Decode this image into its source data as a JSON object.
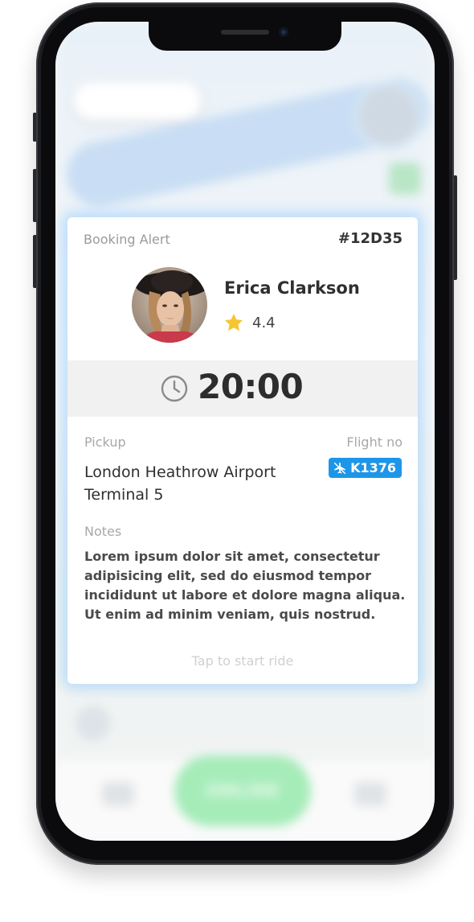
{
  "booking_card": {
    "title": "Booking Alert",
    "booking_id": "#12D35",
    "driver": {
      "name": "Erica Clarkson",
      "rating": "4.4",
      "rating_icon": "star-icon",
      "avatar_icon": "driver-photo"
    },
    "pickup_time": "20:00",
    "time_icon": "clock-icon",
    "pickup": {
      "label": "Pickup",
      "value": "London Heathrow Airport Terminal 5"
    },
    "flight": {
      "label": "Flight no",
      "value": "K1376",
      "icon": "airplane-icon"
    },
    "notes": {
      "label": "Notes",
      "value": "Lorem ipsum dolor sit amet, consectetur adipisicing elit, sed do eiusmod tempor incididunt ut labore et dolore magna aliqua. Ut enim ad minim veniam, quis nostrud."
    },
    "action_label": "Tap to start ride"
  },
  "background": {
    "status_button_label": "ONLINE"
  },
  "colors": {
    "accent_blue": "#1e96e8",
    "star_yellow": "#f7c531",
    "online_green": "#a6ecb9",
    "card_glow": "#78beff"
  }
}
